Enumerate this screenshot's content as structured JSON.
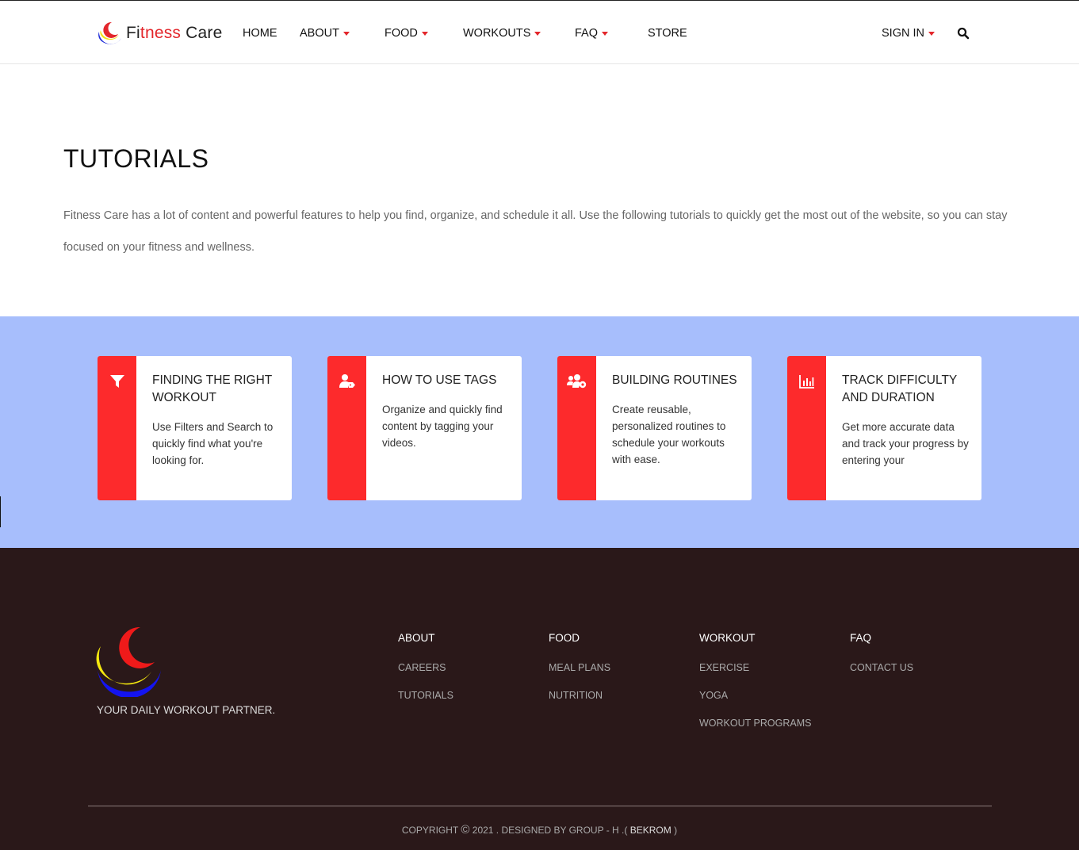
{
  "brand": {
    "prefix": "Fi",
    "accent": "tness",
    "rest": " Care"
  },
  "nav": {
    "home": "HOME",
    "about": "ABOUT",
    "food": "FOOD",
    "workouts": "WORKOUTS",
    "faq": "FAQ",
    "store": "STORE",
    "sign_in": "SIGN IN"
  },
  "hero": {
    "title": "TUTORIALS",
    "text": "Fitness Care has a lot of content and powerful features to help you find, organize, and schedule it all. Use the following tutorials to quickly get the most out of the website, so you can stay focused on your fitness and wellness."
  },
  "cards": [
    {
      "icon": "filter-icon",
      "title": "FINDING THE RIGHT WORKOUT",
      "text": "Use Filters and Search to quickly find what you're looking for."
    },
    {
      "icon": "user-tag-icon",
      "title": "HOW TO USE TAGS",
      "text": "Organize and quickly find content by tagging your videos."
    },
    {
      "icon": "users-cog-icon",
      "title": "BUILDING ROUTINES",
      "text": "Create reusable, personalized routines to schedule your workouts with ease."
    },
    {
      "icon": "chart-bar-icon",
      "title": "TRACK DIFFICULTY AND DURATION",
      "text": "Get more accurate data and track your progress by entering your"
    }
  ],
  "footer": {
    "tagline": "YOUR DAILY WORKOUT PARTNER.",
    "columns": [
      {
        "heading": "ABOUT",
        "links": [
          "CAREERS",
          "TUTORIALS"
        ]
      },
      {
        "heading": "FOOD",
        "links": [
          "MEAL PLANS",
          "NUTRITION"
        ]
      },
      {
        "heading": "WORKOUT",
        "links": [
          "EXERCISE",
          "YOGA",
          "WORKOUT PROGRAMS"
        ]
      },
      {
        "heading": "FAQ",
        "links": [
          "CONTACT US"
        ]
      }
    ],
    "copyright_prefix": "COPYRIGHT",
    "copyright_symbol": "©",
    "copyright_middle": "2021 . DESIGNED BY GROUP - H .(",
    "team": "BEKROM",
    "copyright_suffix": ")"
  },
  "colors": {
    "accent_red": "#fd2a2c",
    "feature_bg": "#a7befc",
    "footer_bg": "#2a1819"
  }
}
